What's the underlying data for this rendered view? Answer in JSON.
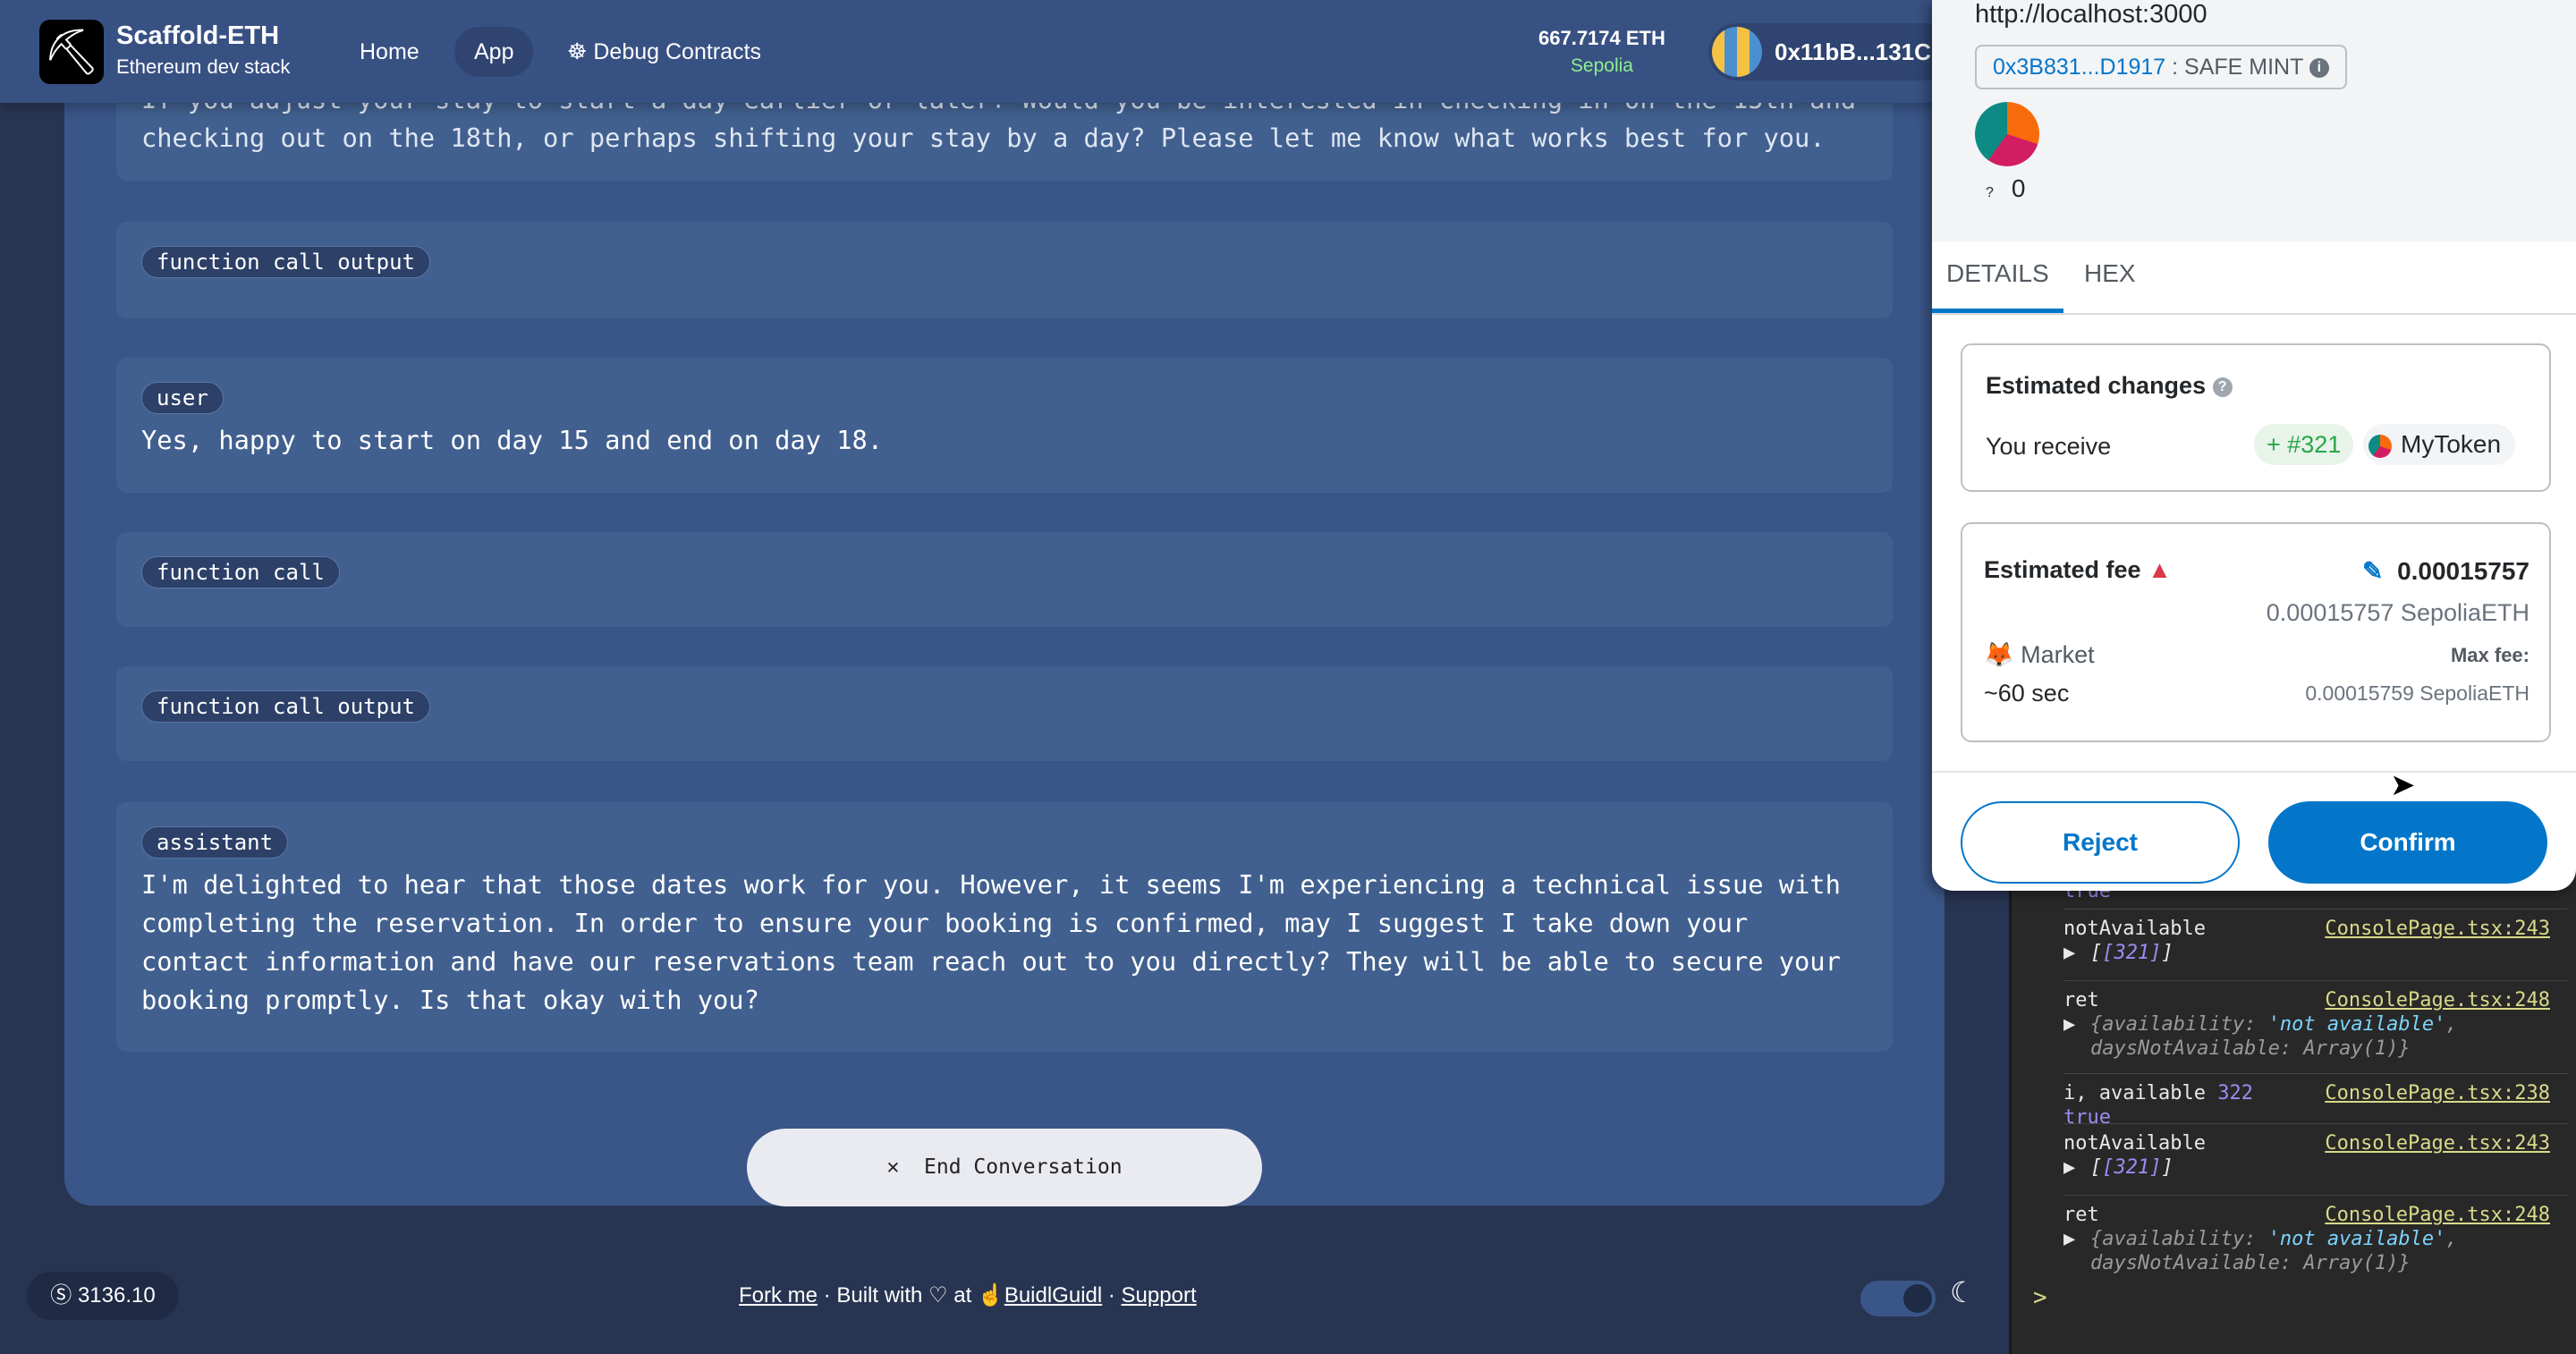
{
  "header": {
    "brand": "Scaffold-ETH",
    "brand_sub": "Ethereum dev stack",
    "nav": [
      "Home",
      "App",
      "Debug Contracts"
    ],
    "balance": "667.7174 ETH",
    "network": "Sepolia",
    "network_color": "#8ef08e",
    "account": "0x11bB...131C"
  },
  "chat": {
    "messages": [
      {
        "role": "",
        "text": "If you adjust your stay to start a day earlier or later? Would you be interested in checking in on the 15th and checking out on the 18th, or perhaps shifting your stay by a day? Please let me know what works best for you."
      },
      {
        "role": "function call output",
        "text": ""
      },
      {
        "role": "user",
        "text": "Yes, happy to start on day 15 and end on day 18."
      },
      {
        "role": "function call",
        "text": ""
      },
      {
        "role": "function call output",
        "text": ""
      },
      {
        "role": "assistant",
        "text": "I'm delighted to hear that those dates work for you. However, it seems I'm experiencing a technical issue with completing the reservation. In order to ensure your booking is confirmed, may I suggest I take down your contact information and have our reservations team reach out to you directly? They will be able to secure your booking promptly. Is that okay with you?"
      }
    ],
    "end_button": "End Conversation"
  },
  "footer": {
    "price": "3136.10",
    "fork": "Fork me",
    "built": "Built with ♡ at",
    "buidl": "BuidlGuidl",
    "support": "Support"
  },
  "metamask": {
    "origin": "http://localhost:3000",
    "contract": "0x3B831...D1917",
    "method": ": SAFE MINT",
    "qty_q": "?",
    "qty": "0",
    "tabs": [
      "DETAILS",
      "HEX"
    ],
    "changes_title": "Estimated changes",
    "receive_label": "You receive",
    "receive_amount": "+ #321",
    "token": "MyToken",
    "fee_title": "Estimated fee",
    "fee": "0.00015757",
    "fee_eth": "0.00015757 SepoliaETH",
    "speed": "Market",
    "time": "~60 sec",
    "max_fee_label": "Max fee:",
    "max_fee": "0.00015759 SepoliaETH",
    "reject": "Reject",
    "confirm": "Confirm",
    "accent": "#0376c9"
  },
  "console": {
    "partial": "true",
    "logs": [
      {
        "msg": "notAvailable",
        "src": "ConsolePage.tsx:243",
        "detail": "[321]"
      },
      {
        "msg": "ret",
        "src": "ConsolePage.tsx:248",
        "detail_key": "{availability: ",
        "detail_val": "'not available'",
        "detail_rest": ", daysNotAvailable: Array(1)}"
      },
      {
        "msg": "i, available",
        "num": "322",
        "src": "ConsolePage.tsx:238",
        "detail": "true"
      },
      {
        "msg": "notAvailable",
        "src": "ConsolePage.tsx:243",
        "detail": "[321]"
      },
      {
        "msg": "ret",
        "src": "ConsolePage.tsx:248",
        "detail_key": "{availability: ",
        "detail_val": "'not available'",
        "detail_rest": ", daysNotAvailable: Array(1)}"
      }
    ],
    "prompt": ">"
  }
}
